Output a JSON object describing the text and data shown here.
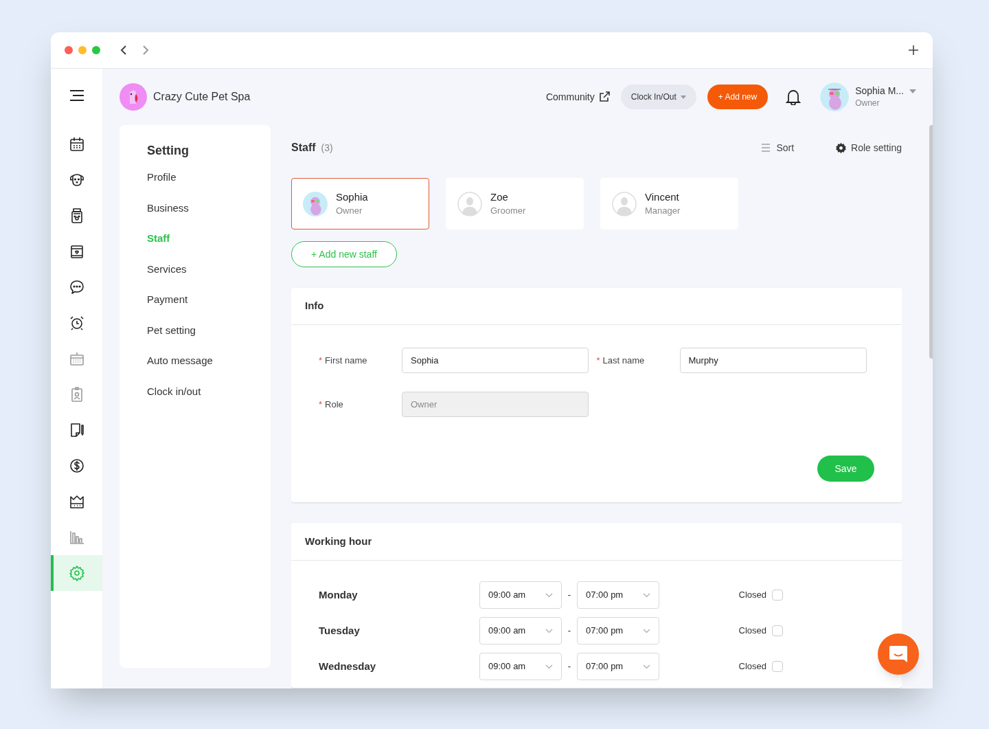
{
  "header": {
    "business_name": "Crazy Cute Pet Spa",
    "community": "Community",
    "clock_button": "Clock In/Out",
    "add_button": "+ Add new",
    "user": {
      "name": "Sophia M...",
      "role": "Owner"
    }
  },
  "sidebar": {
    "items": [
      {
        "kind": "calendar",
        "dimmed": false,
        "selected": false
      },
      {
        "kind": "dog",
        "dimmed": false,
        "selected": false
      },
      {
        "kind": "food-bag",
        "dimmed": false,
        "selected": false
      },
      {
        "kind": "heart-box",
        "dimmed": false,
        "selected": false
      },
      {
        "kind": "chat",
        "dimmed": false,
        "selected": false
      },
      {
        "kind": "alarm",
        "dimmed": false,
        "selected": false
      },
      {
        "kind": "calendar-grid",
        "dimmed": true,
        "selected": false
      },
      {
        "kind": "badge",
        "dimmed": true,
        "selected": false
      },
      {
        "kind": "note",
        "dimmed": false,
        "selected": false
      },
      {
        "kind": "dollar",
        "dimmed": false,
        "selected": false
      },
      {
        "kind": "crown",
        "dimmed": false,
        "selected": false
      },
      {
        "kind": "bar-chart",
        "dimmed": true,
        "selected": false
      },
      {
        "kind": "settings",
        "dimmed": false,
        "selected": true
      }
    ]
  },
  "settings_menu": {
    "title": "Setting",
    "items": [
      {
        "label": "Profile",
        "selected": false
      },
      {
        "label": "Business",
        "selected": false
      },
      {
        "label": "Staff",
        "selected": true
      },
      {
        "label": "Services",
        "selected": false
      },
      {
        "label": "Payment",
        "selected": false
      },
      {
        "label": "Pet setting",
        "selected": false
      },
      {
        "label": "Auto message",
        "selected": false
      },
      {
        "label": "Clock in/out",
        "selected": false
      }
    ]
  },
  "staff": {
    "title": "Staff",
    "count": "(3)",
    "sort": "Sort",
    "role_setting": "Role setting",
    "add_button": "+ Add new staff",
    "members": [
      {
        "name": "Sophia",
        "role": "Owner",
        "selected": true,
        "kind": "picture"
      },
      {
        "name": "Zoe",
        "role": "Groomer",
        "selected": false,
        "kind": "silhouette"
      },
      {
        "name": "Vincent",
        "role": "Manager",
        "selected": false,
        "kind": "silhouette"
      }
    ]
  },
  "info": {
    "title": "Info",
    "save": "Save",
    "fields": [
      {
        "required_mark": "*",
        "label": "First name",
        "value": "Sophia",
        "disabled": false
      },
      {
        "required_mark": "*",
        "label": "Last name",
        "value": "Murphy",
        "disabled": false
      },
      {
        "required_mark": "*",
        "label": "Role",
        "placeholder": "Owner",
        "disabled": true
      }
    ]
  },
  "working_hour": {
    "title": "Working hour",
    "days": [
      {
        "day": "Monday",
        "open": "09:00 am",
        "separator": "-",
        "close": "07:00 pm",
        "closed_label": "Closed",
        "closed": false
      },
      {
        "day": "Tuesday",
        "open": "09:00 am",
        "separator": "-",
        "close": "07:00 pm",
        "closed_label": "Closed",
        "closed": false
      },
      {
        "day": "Wednesday",
        "open": "09:00 am",
        "separator": "-",
        "close": "07:00 pm",
        "closed_label": "Closed",
        "closed": false
      }
    ]
  }
}
